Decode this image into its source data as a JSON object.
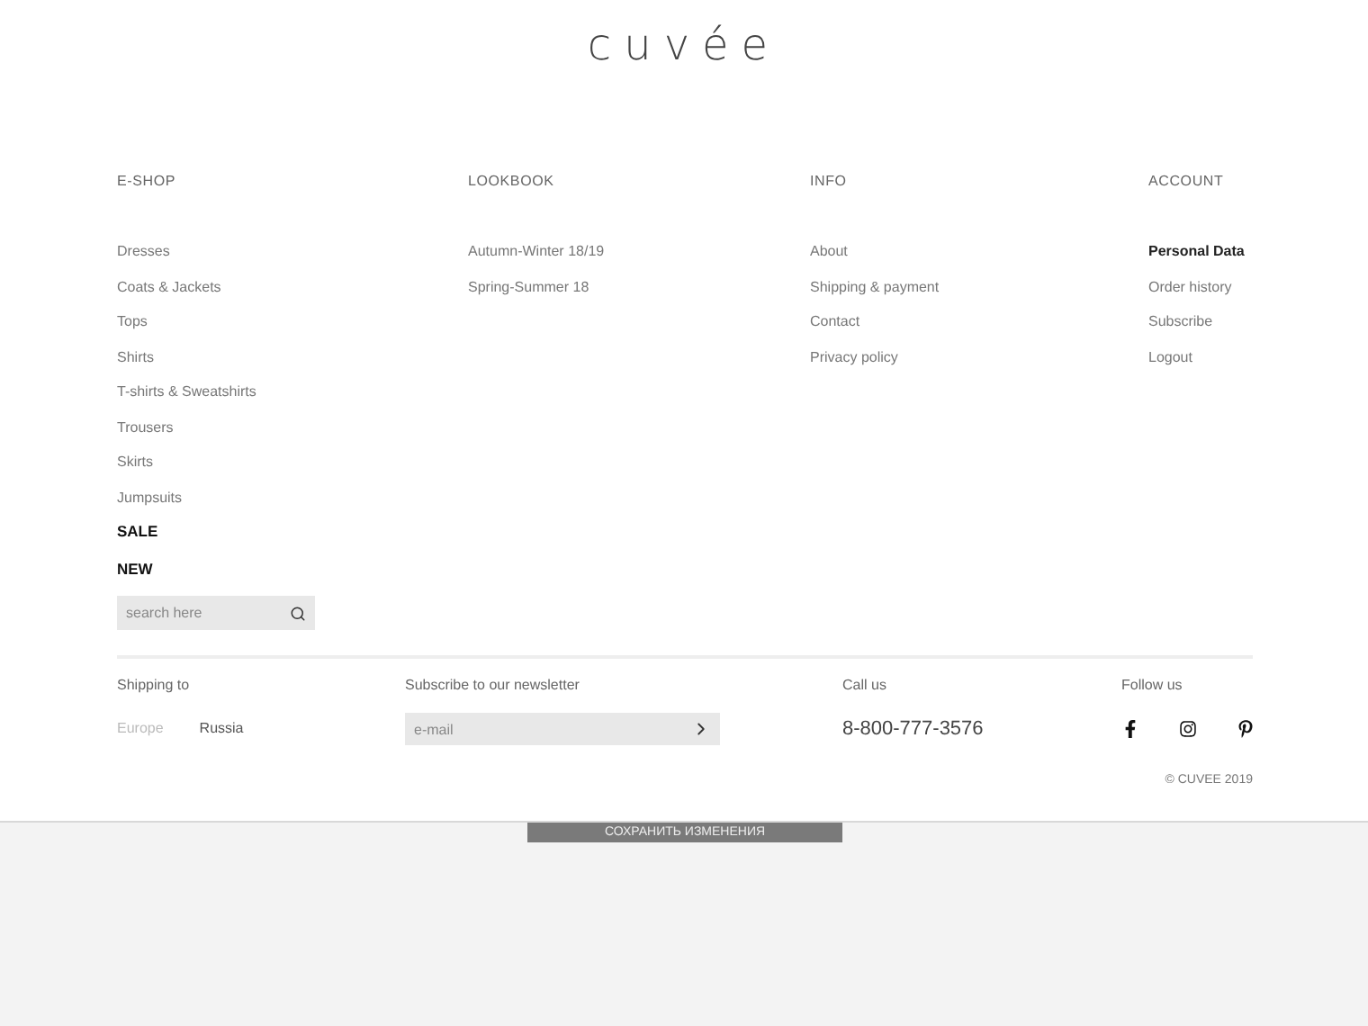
{
  "logo": "cuvée",
  "columns": [
    {
      "heading": "E-SHOP",
      "links": [
        {
          "label": "Dresses",
          "kind": "link"
        },
        {
          "label": "Coats & Jackets",
          "kind": "link"
        },
        {
          "label": "Tops",
          "kind": "link"
        },
        {
          "label": "Shirts",
          "kind": "link"
        },
        {
          "label": "T-shirts & Sweatshirts",
          "kind": "link"
        },
        {
          "label": "Trousers",
          "kind": "link"
        },
        {
          "label": "Skirts",
          "kind": "link"
        },
        {
          "label": "Jumpsuits",
          "kind": "link"
        },
        {
          "label": "SALE",
          "kind": "bold"
        },
        {
          "label": "NEW",
          "kind": "bold"
        }
      ],
      "search": {
        "placeholder": "search here"
      }
    },
    {
      "heading": "LOOKBOOK",
      "links": [
        {
          "label": "Autumn-Winter 18/19",
          "kind": "link"
        },
        {
          "label": "Spring-Summer 18",
          "kind": "link"
        }
      ]
    },
    {
      "heading": "INFO",
      "links": [
        {
          "label": "About",
          "kind": "link"
        },
        {
          "label": "Shipping & payment",
          "kind": "link"
        },
        {
          "label": "Contact",
          "kind": "link"
        },
        {
          "label": "Privacy policy",
          "kind": "link"
        }
      ]
    },
    {
      "heading": "ACCOUNT",
      "links": [
        {
          "label": "Personal Data",
          "kind": "link",
          "selected": true
        },
        {
          "label": "Order history",
          "kind": "link",
          "selected": false
        },
        {
          "label": "Subscribe",
          "kind": "link",
          "selected": false
        },
        {
          "label": "Logout",
          "kind": "link",
          "selected": false
        }
      ]
    }
  ],
  "shipping": {
    "label": "Shipping to",
    "regions": [
      {
        "label": "Europe",
        "selected": false
      },
      {
        "label": "Russia",
        "selected": true
      }
    ]
  },
  "newsletter": {
    "label": "Subscribe to our newsletter",
    "placeholder": "e-mail"
  },
  "call": {
    "label": "Call us",
    "phone": "8-800-777-3576"
  },
  "follow": {
    "label": "Follow us",
    "networks": [
      {
        "kind": "facebook"
      },
      {
        "kind": "instagram"
      },
      {
        "kind": "pinterest"
      }
    ]
  },
  "copyright": "© CUVEE 2019",
  "save_button": "СОХРАНИТЬ ИЗМЕНЕНИЯ"
}
